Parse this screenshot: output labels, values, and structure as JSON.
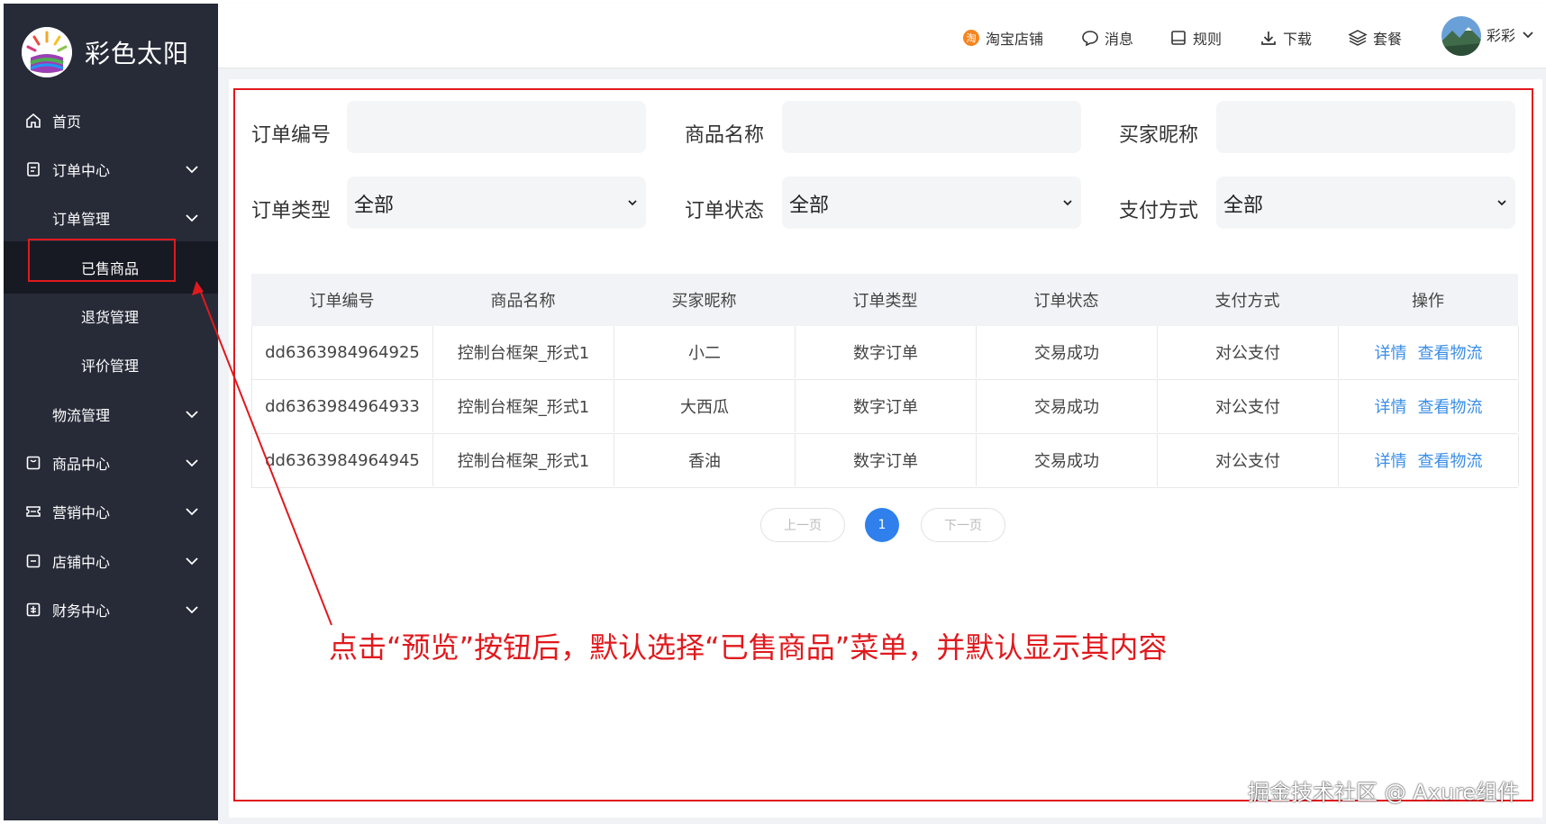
{
  "app": {
    "brand": "彩色太阳"
  },
  "header": {
    "taobao": "淘宝店铺",
    "messages": "消息",
    "rules": "规则",
    "download": "下载",
    "plans": "套餐",
    "user": "彩彩"
  },
  "sidebar": {
    "items": [
      {
        "label": "首页",
        "icon": "home-icon"
      },
      {
        "label": "订单中心",
        "icon": "document-icon"
      },
      {
        "label": "订单管理"
      },
      {
        "label": "已售商品"
      },
      {
        "label": "退货管理"
      },
      {
        "label": "评价管理"
      },
      {
        "label": "物流管理"
      },
      {
        "label": "商品中心",
        "icon": "box-icon"
      },
      {
        "label": "营销中心",
        "icon": "ticket-icon"
      },
      {
        "label": "店铺中心",
        "icon": "store-icon"
      },
      {
        "label": "财务中心",
        "icon": "finance-icon"
      }
    ],
    "selected": "已售商品"
  },
  "filters": {
    "order_no": "订单编号",
    "product_name": "商品名称",
    "buyer_nick": "买家昵称",
    "order_type": "订单类型",
    "order_type_value": "全部",
    "order_status": "订单状态",
    "order_status_value": "全部",
    "pay_method": "支付方式",
    "pay_method_value": "全部"
  },
  "table": {
    "headers": [
      "订单编号",
      "商品名称",
      "买家昵称",
      "订单类型",
      "订单状态",
      "支付方式",
      "操作"
    ],
    "rows": [
      {
        "order_no": "dd6363984964925",
        "product": "控制台框架_形式1",
        "buyer": "小二",
        "type": "数字订单",
        "status": "交易成功",
        "pay": "对公支付"
      },
      {
        "order_no": "dd6363984964933",
        "product": "控制台框架_形式1",
        "buyer": "大西瓜",
        "type": "数字订单",
        "status": "交易成功",
        "pay": "对公支付"
      },
      {
        "order_no": "dd6363984964945",
        "product": "控制台框架_形式1",
        "buyer": "香油",
        "type": "数字订单",
        "status": "交易成功",
        "pay": "对公支付"
      }
    ],
    "action_detail": "详情",
    "action_logistics": "查看物流"
  },
  "pagination": {
    "prev": "上一页",
    "current": "1",
    "next": "下一页"
  },
  "annotation": "点击“预览”按钮后，默认选择“已售商品”菜单，并默认显示其内容",
  "watermark": "掘金技术社区 @ Axure组件",
  "colors": {
    "sidebar": "#272b38",
    "accent": "#2f80ed",
    "link": "#3a8ee6",
    "annotation": "#e0191d"
  }
}
